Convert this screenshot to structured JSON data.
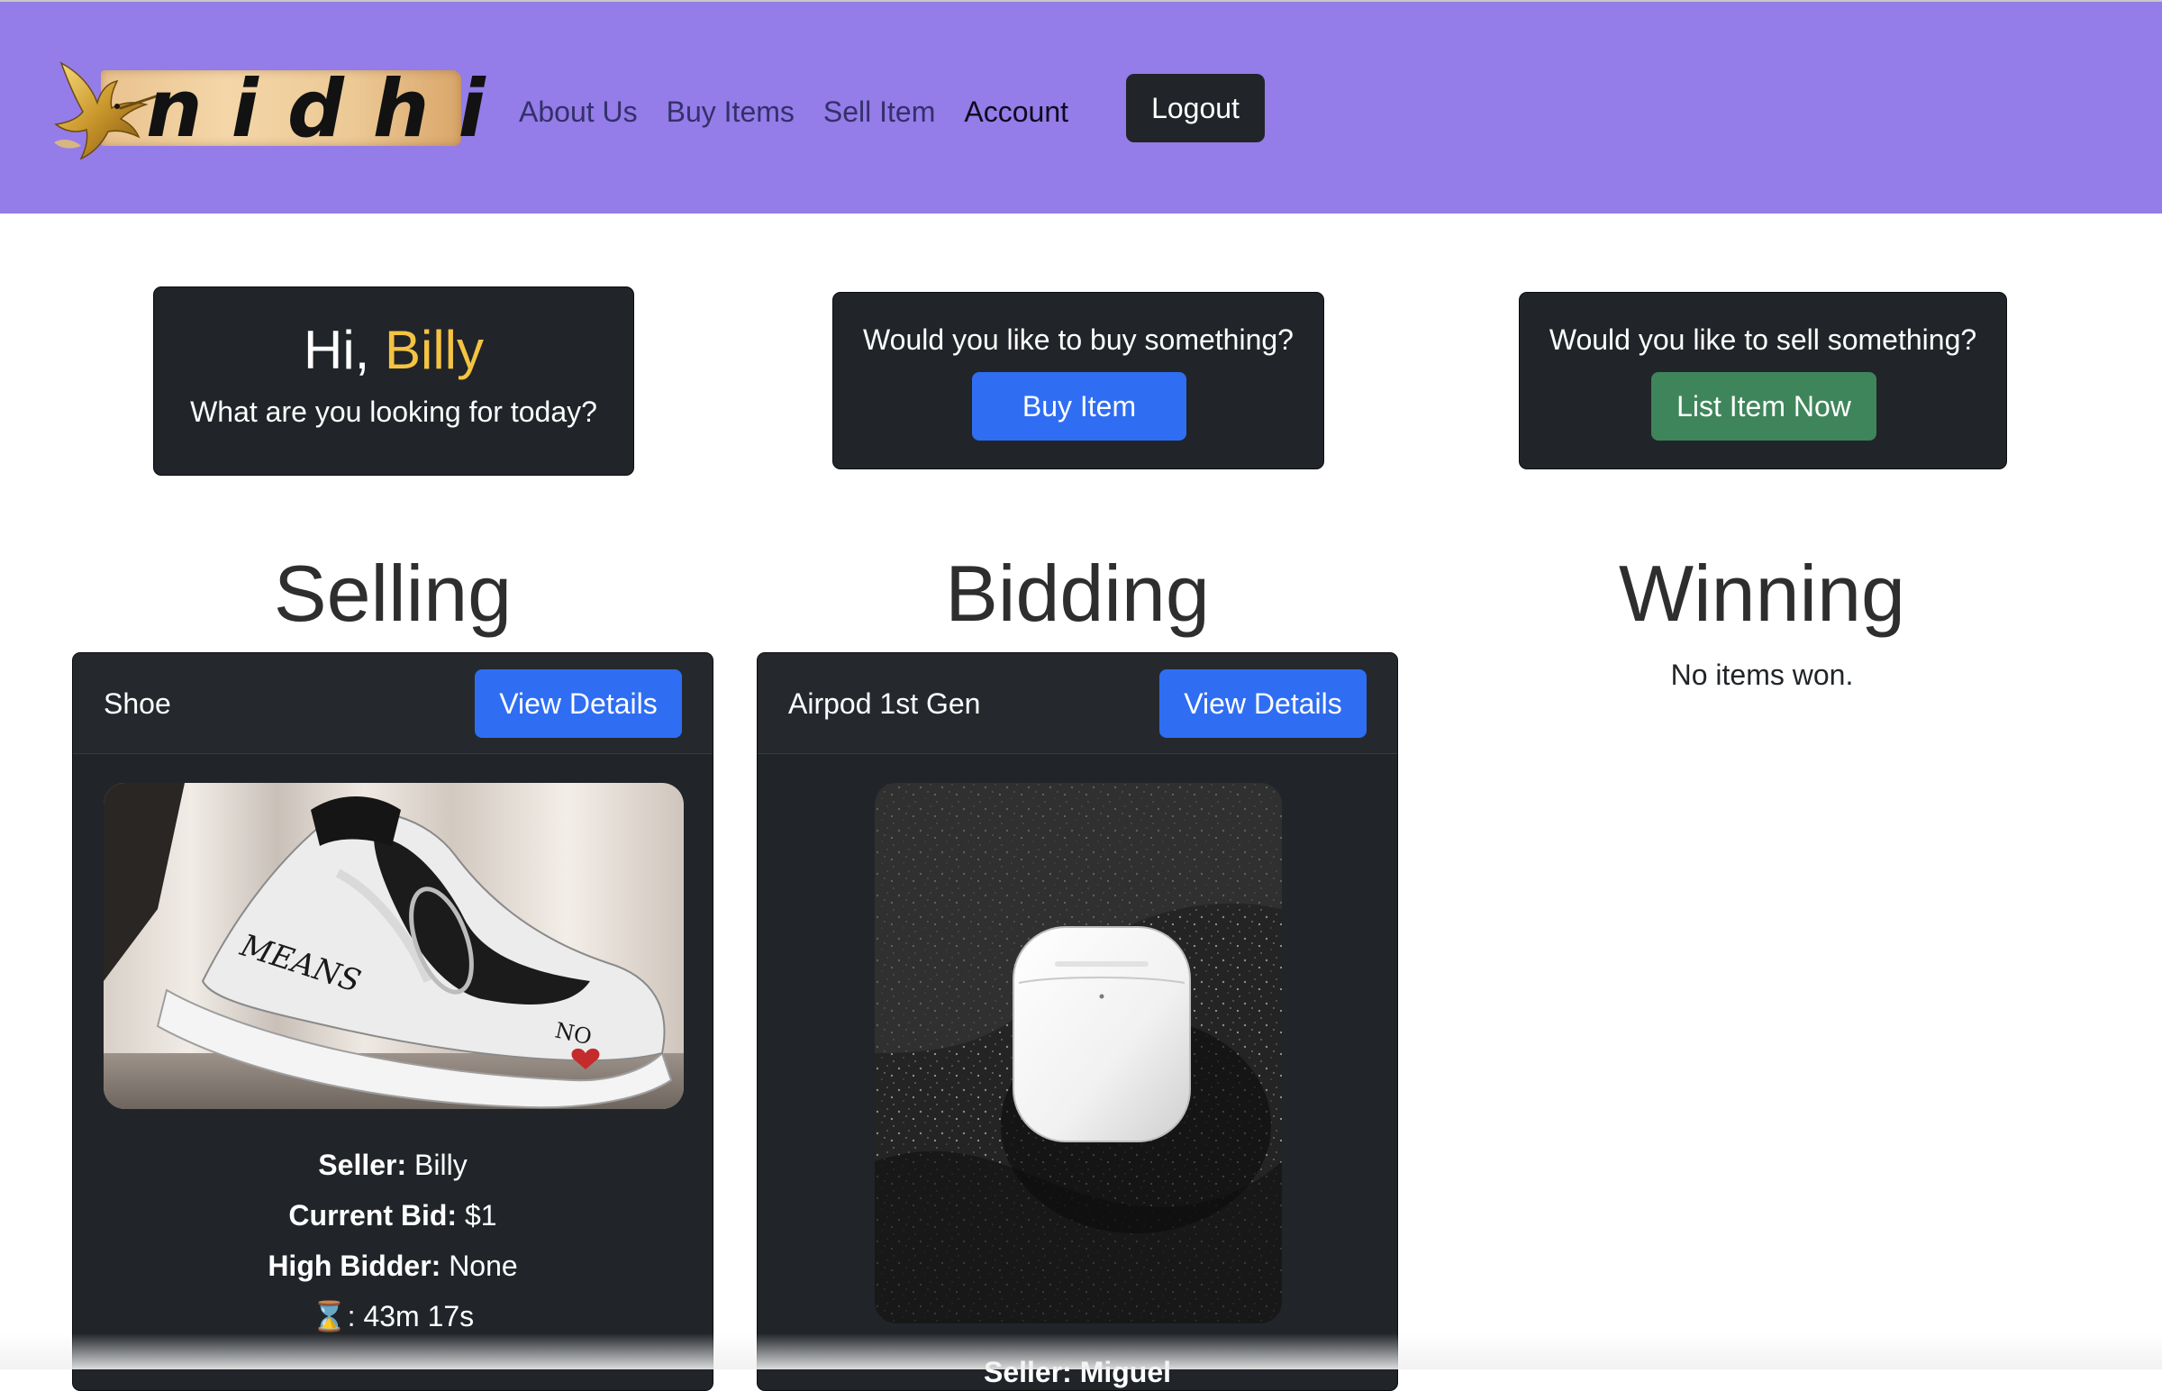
{
  "nav": {
    "brand": "nidhi",
    "links": [
      {
        "label": "About Us",
        "active": false
      },
      {
        "label": "Buy Items",
        "active": false
      },
      {
        "label": "Sell Item",
        "active": false
      },
      {
        "label": "Account",
        "active": true
      }
    ],
    "logout_label": "Logout"
  },
  "greeting": {
    "hi": "Hi,",
    "name": "Billy",
    "subtitle": "What are you looking for today?"
  },
  "buy_cta": {
    "question": "Would you like to buy something?",
    "button": "Buy Item"
  },
  "sell_cta": {
    "question": "Would you like to sell something?",
    "button": "List Item Now"
  },
  "sections": {
    "selling": "Selling",
    "bidding": "Bidding",
    "winning": "Winning",
    "winning_empty": "No items won."
  },
  "selling_item": {
    "name": "Shoe",
    "view_details": "View Details",
    "seller_label": "Seller:",
    "seller": "Billy",
    "bid_label": "Current Bid:",
    "bid": "$1",
    "bidder_label": "High Bidder:",
    "bidder": "None",
    "timer_label": "⌛:",
    "timer": "43m 17s"
  },
  "bidding_item": {
    "name": "Airpod 1st Gen",
    "view_details": "View Details",
    "seller_partial": "Seller: Miguel"
  },
  "colors": {
    "navbar": "#947ce9",
    "card": "#212529",
    "primary": "#2f6ef2",
    "success": "#3f855b",
    "name_highlight": "#f5c342"
  }
}
